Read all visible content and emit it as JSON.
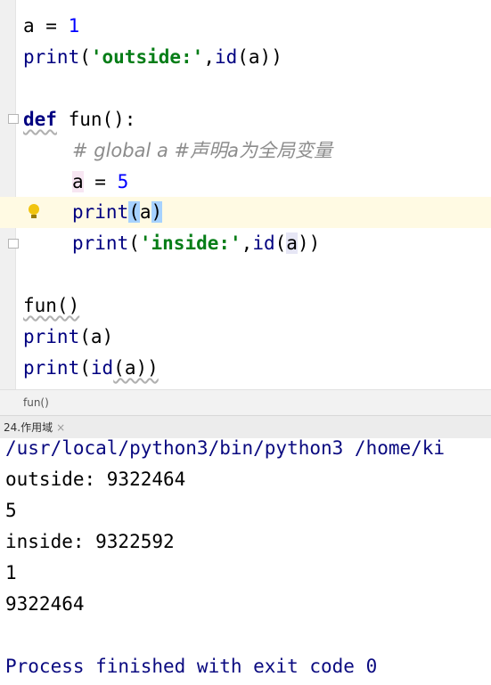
{
  "editor": {
    "lines": {
      "l1": {
        "a": "a",
        "eq": " = ",
        "num": "1"
      },
      "l2": {
        "fn": "print",
        "o": "(",
        "s": "'outside:'",
        "c": ",",
        "id": "id",
        "r": "(a))"
      },
      "l4": {
        "kw": "def",
        "rest": " fun():"
      },
      "l5": {
        "comment": "# global a #声明a为全局变量"
      },
      "l6": {
        "a": "a",
        "eq": " = ",
        "num": "5"
      },
      "l7": {
        "fn": "print",
        "o": "(",
        "a": "a",
        "c": ")"
      },
      "l8": {
        "fn": "print",
        "o": "(",
        "s": "'inside:'",
        "c": ",",
        "id": "id",
        "p": "(",
        "a": "a",
        "r": "))"
      },
      "l10": {
        "text": "fun()"
      },
      "l11": {
        "fn": "print",
        "r": "(a)"
      },
      "l12": {
        "fn": "print",
        "o": "(",
        "id": "id",
        "r": "(a))"
      }
    }
  },
  "breadcrumb": {
    "label": "fun()"
  },
  "run_tab": {
    "label": "24.作用域",
    "close": "×"
  },
  "console": {
    "lines": [
      "/usr/local/python3/bin/python3 /home/ki",
      "outside: 9322464",
      "5",
      "inside: 9322592",
      "1",
      "9322464",
      "",
      "Process finished with exit code 0"
    ]
  }
}
